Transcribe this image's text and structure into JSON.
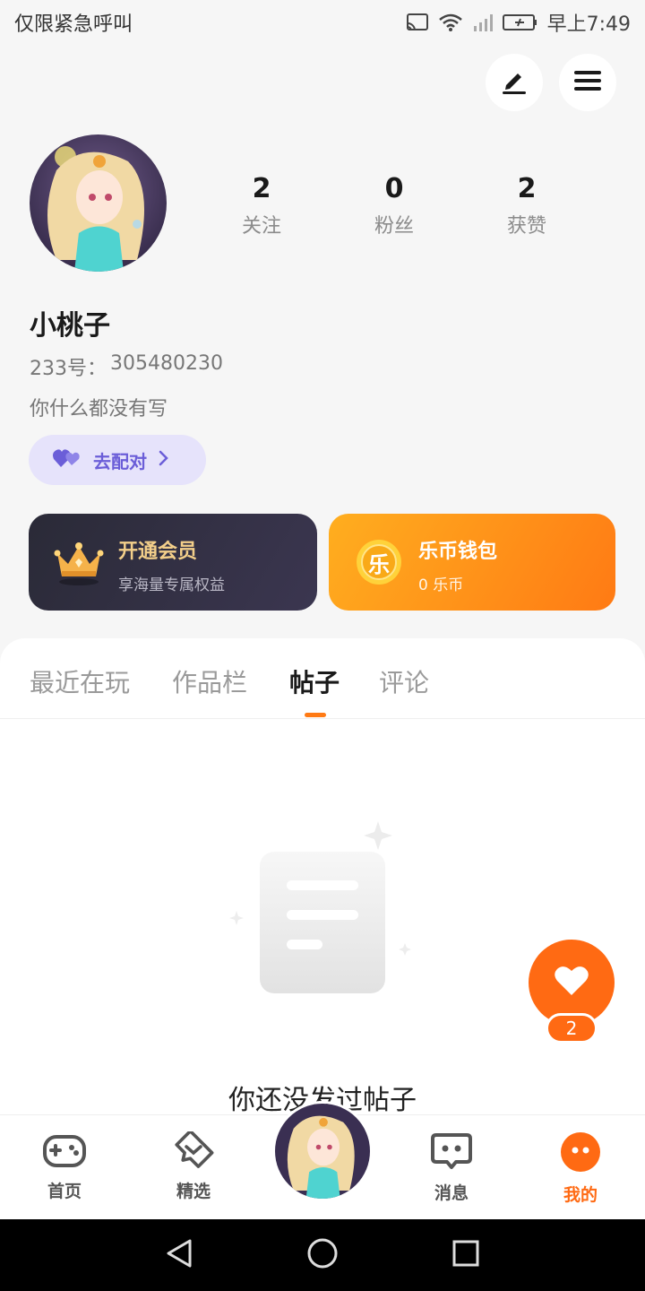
{
  "status_bar": {
    "left_text": "仅限紧急呼叫",
    "time": "早上7:49"
  },
  "top_actions": {
    "edit_icon": "edit-pen-icon",
    "menu_icon": "hamburger-menu-icon"
  },
  "profile": {
    "name": "小桃子",
    "uid_label": "233号：",
    "uid_value": "305480230",
    "bio": "你什么都没有写",
    "stats": [
      {
        "value": "2",
        "label": "关注"
      },
      {
        "value": "0",
        "label": "粉丝"
      },
      {
        "value": "2",
        "label": "获赞"
      }
    ]
  },
  "match_button": {
    "label": "去配对"
  },
  "cards": {
    "vip": {
      "title": "开通会员",
      "subtitle": "享海量专属权益"
    },
    "wallet": {
      "title": "乐币钱包",
      "subtitle": "0 乐币",
      "coin_char": "乐"
    }
  },
  "tabs": [
    {
      "label": "最近在玩",
      "active": false
    },
    {
      "label": "作品栏",
      "active": false
    },
    {
      "label": "帖子",
      "active": true
    },
    {
      "label": "评论",
      "active": false
    }
  ],
  "empty_state": {
    "text": "你还没发过帖子"
  },
  "fab": {
    "count": "2"
  },
  "bottom_nav": [
    {
      "label": "首页",
      "icon": "gamepad-icon",
      "active": false
    },
    {
      "label": "精选",
      "icon": "heart-chat-icon",
      "active": false
    },
    {
      "label": "消息",
      "icon": "message-bubble-icon",
      "active": false
    },
    {
      "label": "我的",
      "icon": "profile-face-icon",
      "active": true
    }
  ],
  "colors": {
    "accent": "#ff6a13",
    "purple": "#6b5ed8",
    "gold": "#f3cf8a"
  }
}
